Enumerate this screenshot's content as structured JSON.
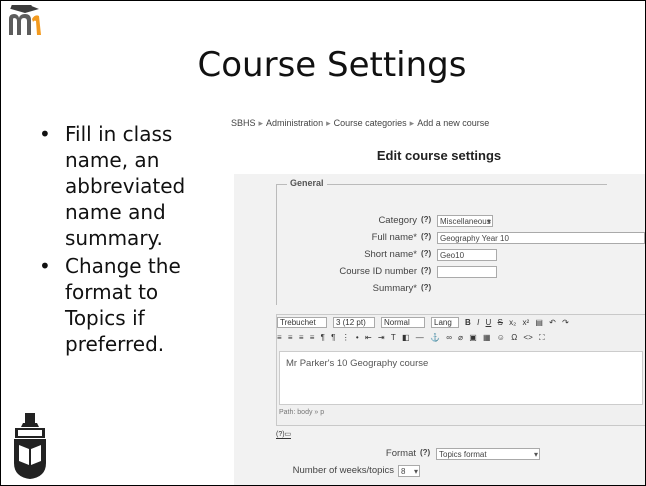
{
  "slide": {
    "title": "Course Settings",
    "bullets": [
      "Fill in class name, an abbreviated name and summary.",
      "Change the format to Topics if preferred."
    ]
  },
  "screenshot": {
    "breadcrumb": [
      "SBHS",
      "Administration",
      "Course categories",
      "Add a new course"
    ],
    "heading": "Edit course settings",
    "section": "General",
    "fields": {
      "category_label": "Category",
      "category_value": "Miscellaneous",
      "fullname_label": "Full name*",
      "fullname_value": "Geography Year 10",
      "shortname_label": "Short name*",
      "shortname_value": "Geo10",
      "idnumber_label": "Course ID number",
      "summary_label": "Summary*",
      "format_label": "Format",
      "format_value": "Topics format",
      "weeks_label": "Number of weeks/topics",
      "weeks_value": "8"
    },
    "editor": {
      "font": "Trebuchet",
      "size": "3 (12 pt)",
      "style": "Normal",
      "lang": "Lang",
      "content": "Mr Parker's 10 Geography course",
      "path": "Path: body » p"
    },
    "help_glyph": "(?)"
  }
}
